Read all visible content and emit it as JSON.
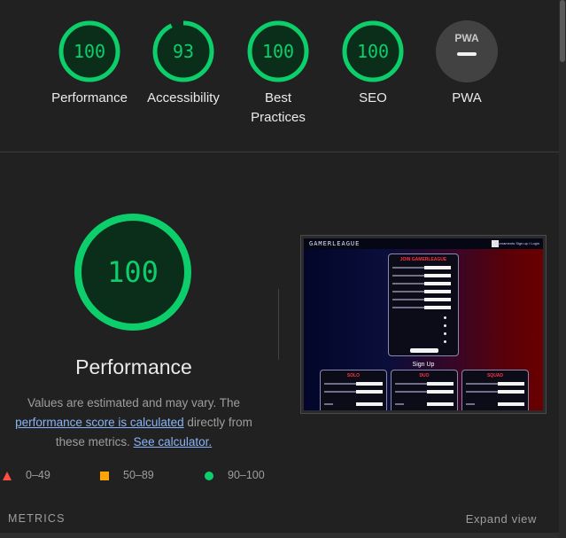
{
  "colors": {
    "pass": "#0cce6b",
    "pass_fill": "#0b3a1f",
    "pass_text": "#0cce6b",
    "na": "#9e9e9e",
    "fail": "#ff4e42",
    "average": "#ffa400",
    "link": "#8ab4f8"
  },
  "categories": [
    {
      "score": "100",
      "label": "Performance",
      "value": 100
    },
    {
      "score": "93",
      "label": "Accessibility",
      "value": 93
    },
    {
      "score": "100",
      "label": "Best Practices",
      "label_line1": "Best",
      "label_line2": "Practices",
      "value": 100
    },
    {
      "score": "100",
      "label": "SEO",
      "value": 100
    }
  ],
  "pwa": {
    "badge": "PWA",
    "label": "PWA",
    "icon": "dash-icon"
  },
  "main": {
    "score": "100",
    "value": 100,
    "title": "Performance",
    "desc_part1": "Values are estimated and may vary. The",
    "desc_link1": "performance score is calculated",
    "desc_part2": " directly from these metrics. ",
    "desc_link2": "See calculator."
  },
  "screenshot": {
    "logo": "GAMERLEAGUE",
    "nav_links": "Tournaments   Sign up / Login",
    "join_title": "JOIN GAMERLEAGUE",
    "signup_title": "Sign Up",
    "solo": "SOLO",
    "duo": "DUO",
    "squad": "SQUAD"
  },
  "legend": [
    {
      "range": "0–49",
      "shape": "triangle-icon"
    },
    {
      "range": "50–89",
      "shape": "square-icon"
    },
    {
      "range": "90–100",
      "shape": "circle-icon"
    }
  ],
  "footer": {
    "metrics_label": "METRICS",
    "expand_label": "Expand view"
  }
}
